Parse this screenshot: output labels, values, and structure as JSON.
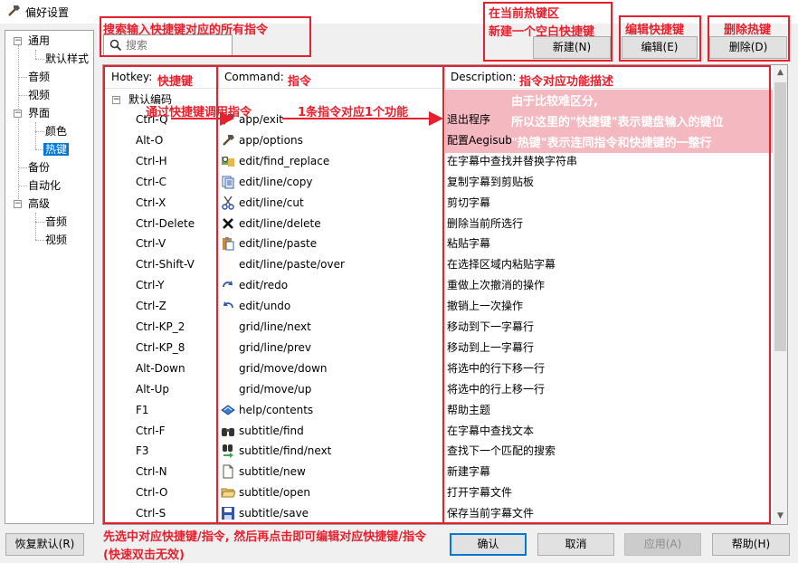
{
  "window": {
    "title": "偏好设置"
  },
  "nav": {
    "items": [
      {
        "label": "通用"
      },
      {
        "label": "默认样式"
      },
      {
        "label": "音频"
      },
      {
        "label": "视频"
      },
      {
        "label": "界面"
      },
      {
        "label": "颜色"
      },
      {
        "label": "热键"
      },
      {
        "label": "备份"
      },
      {
        "label": "自动化"
      },
      {
        "label": "高级"
      },
      {
        "label": "音频"
      },
      {
        "label": "视频"
      }
    ],
    "selected": "热键"
  },
  "search": {
    "placeholder": "搜索"
  },
  "buttons": {
    "new": "新建(N)",
    "edit": "编辑(E)",
    "delete": "删除(D)",
    "restore": "恢复默认(R)",
    "ok": "确认",
    "cancel": "取消",
    "apply": "应用(A)",
    "help": "帮助(H)"
  },
  "table": {
    "headers": {
      "hotkey": "Hotkey",
      "command": "Command",
      "description": "Description"
    },
    "group": "默认编码",
    "rows": [
      {
        "hotkey": "Ctrl-Q",
        "command": "app/exit",
        "description": "退出程序",
        "icon": "exit-icon"
      },
      {
        "hotkey": "Alt-O",
        "command": "app/options",
        "description": "配置Aegisub",
        "icon": "options-icon"
      },
      {
        "hotkey": "Ctrl-H",
        "command": "edit/find_replace",
        "description": "在字幕中查找并替换字符串",
        "icon": "find-replace-icon"
      },
      {
        "hotkey": "Ctrl-C",
        "command": "edit/line/copy",
        "description": "复制字幕到剪贴板",
        "icon": "copy-icon"
      },
      {
        "hotkey": "Ctrl-X",
        "command": "edit/line/cut",
        "description": "剪切字幕",
        "icon": "cut-icon"
      },
      {
        "hotkey": "Ctrl-Delete",
        "command": "edit/line/delete",
        "description": "删除当前所选行",
        "icon": "delete-icon"
      },
      {
        "hotkey": "Ctrl-V",
        "command": "edit/line/paste",
        "description": "粘贴字幕",
        "icon": "paste-icon"
      },
      {
        "hotkey": "Ctrl-Shift-V",
        "command": "edit/line/paste/over",
        "description": "在选择区域内粘贴字幕",
        "icon": ""
      },
      {
        "hotkey": "Ctrl-Y",
        "command": "edit/redo",
        "description": "重做上次撤消的操作",
        "icon": "redo-icon"
      },
      {
        "hotkey": "Ctrl-Z",
        "command": "edit/undo",
        "description": "撤销上一次操作",
        "icon": "undo-icon"
      },
      {
        "hotkey": "Ctrl-KP_2",
        "command": "grid/line/next",
        "description": "移动到下一字幕行",
        "icon": ""
      },
      {
        "hotkey": "Ctrl-KP_8",
        "command": "grid/line/prev",
        "description": "移动到上一字幕行",
        "icon": ""
      },
      {
        "hotkey": "Alt-Down",
        "command": "grid/move/down",
        "description": "将选中的行下移一行",
        "icon": ""
      },
      {
        "hotkey": "Alt-Up",
        "command": "grid/move/up",
        "description": "将选中的行上移一行",
        "icon": ""
      },
      {
        "hotkey": "F1",
        "command": "help/contents",
        "description": "帮助主题",
        "icon": "help-book-icon"
      },
      {
        "hotkey": "Ctrl-F",
        "command": "subtitle/find",
        "description": "在字幕中查找文本",
        "icon": "binoculars-icon"
      },
      {
        "hotkey": "F3",
        "command": "subtitle/find/next",
        "description": "查找下一个匹配的搜索",
        "icon": "find-next-icon"
      },
      {
        "hotkey": "Ctrl-N",
        "command": "subtitle/new",
        "description": "新建字幕",
        "icon": "new-file-icon"
      },
      {
        "hotkey": "Ctrl-O",
        "command": "subtitle/open",
        "description": "打开字幕文件",
        "icon": "open-folder-icon"
      },
      {
        "hotkey": "Ctrl-S",
        "command": "subtitle/save",
        "description": "保存当前字幕文件",
        "icon": "save-icon"
      }
    ]
  },
  "annotations": {
    "search_note": "搜索输入快捷键对应的所有指令",
    "new_note_line1": "在当前热键区",
    "new_note_line2": "新建一个空白快捷键",
    "edit_note": "编辑快捷键",
    "delete_note": "删除热键",
    "hotkey_note": "快捷键",
    "command_note": "指令",
    "description_note": "指令对应功能描述",
    "invoke_note": "通过快捷键调用指令",
    "mapping_note": "1条指令对应1个功能",
    "explain_line1": "由于比较难区分,",
    "explain_line2": "所以这里的\"快捷键\"表示键盘输入的键位",
    "explain_line3": "\"热键\"表示连同指令和快捷键的一整行",
    "bottom_line1": "先选中对应快捷键/指令, 然后再点击即可编辑对应快捷键/指令",
    "bottom_line2": "(快速双击无效)"
  },
  "colors": {
    "annotation": "#e8202e",
    "selection": "#0078d7",
    "highlight_band": "#f4b8c1"
  }
}
